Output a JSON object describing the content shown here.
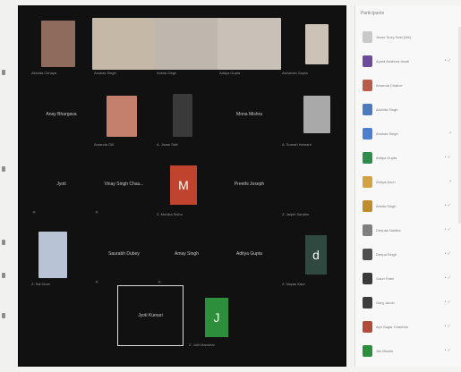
{
  "participants_panel": {
    "title": "Participants",
    "items": [
      {
        "name": "Jesse Suzy Host (Me)",
        "color": "#c9c9c9",
        "status": ""
      },
      {
        "name": "Ayara Andiswa Issati",
        "color": "#6d4a9b",
        "status": "• ✓"
      },
      {
        "name": "Amanda Challoe",
        "color": "#b95c4a",
        "status": ""
      },
      {
        "name": "Akshita Singh",
        "color": "#4b7abf",
        "status": ""
      },
      {
        "name": "Anukas Singh",
        "color": "#4d7fd0",
        "status": "•"
      },
      {
        "name": "Aditya Gupta",
        "color": "#2f8d4b",
        "status": "• ✓"
      },
      {
        "name": "Aneya Anuh",
        "color": "#d2a243",
        "status": "•"
      },
      {
        "name": "Ankita Singh",
        "color": "#bd8d2e",
        "status": "• ✓"
      },
      {
        "name": "Deepak Naidha",
        "color": "#7f7f7f",
        "status": "• ✓"
      },
      {
        "name": "Deepa Singh",
        "color": "#4f4f4f",
        "status": "• ✓"
      },
      {
        "name": "Gauri Patel",
        "color": "#3a3a3a",
        "status": "• ✓"
      },
      {
        "name": "Garg Jacob",
        "color": "#3c3c3c",
        "status": "• ✓"
      },
      {
        "name": "Ayo Sagar Chauhan",
        "color": "#b14d3a",
        "status": "• ✓"
      },
      {
        "name": "Jitu Bhatia",
        "color": "#2c8f3d",
        "status": "• ✓"
      }
    ]
  },
  "meeting": {
    "tiles": [
      {
        "name": "Akshita Chhaya",
        "label": "",
        "video": "#8f6b5d",
        "letter": ""
      },
      {
        "name": "Anukas Singh",
        "label": "",
        "video": "#c5b8a7",
        "letter": ""
      },
      {
        "name": "Ankita Singh",
        "label": "",
        "video": "#bfb7ae",
        "letter": ""
      },
      {
        "name": "Aditya Gupta",
        "label": "",
        "video": "#c9c1b8",
        "letter": ""
      },
      {
        "name": "Ashutosh Gupta",
        "label": "",
        "video": "#ccc2b6",
        "letter": ""
      },
      {
        "name": "",
        "label": "Anay Bhargava",
        "video": "",
        "letter": ""
      },
      {
        "name": "Amanda Gill",
        "label": "",
        "video": "#c47f6d",
        "letter": ""
      },
      {
        "name": "A. Jiwan Seth",
        "label": "",
        "video": "#3a3a3a",
        "letter": ""
      },
      {
        "name": "",
        "label": "Mona Mishra",
        "video": "",
        "letter": ""
      },
      {
        "name": "A. Suresh Hemant",
        "label": "",
        "video": "#a9a9a9",
        "letter": ""
      },
      {
        "name": "",
        "label": "Jyoti",
        "video": "",
        "letter": ""
      },
      {
        "name": "",
        "label": "Vinay Singh Chau...",
        "video": "",
        "letter": ""
      },
      {
        "name": "Z. Monika Sisha",
        "label": "",
        "video": "#c0432d",
        "letter": "M"
      },
      {
        "name": "",
        "label": "Preethi Joseph",
        "video": "",
        "letter": ""
      },
      {
        "name": "Z. Jaiprit Sandhu",
        "label": "",
        "video": "",
        "letter": ""
      },
      {
        "name": "Z. Sai Kiran",
        "label": "",
        "video": "#b8c3d5",
        "letter": ""
      },
      {
        "name": "",
        "label": "Saurabh Dubey",
        "video": "",
        "letter": ""
      },
      {
        "name": "",
        "label": "Amay Singh",
        "video": "",
        "letter": ""
      },
      {
        "name": "",
        "label": "Aditya Gupta",
        "video": "",
        "letter": ""
      },
      {
        "name": "Z. Nayan Kaur",
        "label": "",
        "video": "#2f4940",
        "letter": "d"
      },
      {
        "name": "",
        "label": "Jyoti Kumari",
        "video": "",
        "letter": ""
      },
      {
        "name": "Z. Juhi Manohar",
        "label": "",
        "video": "#2d8f3c",
        "letter": "J"
      }
    ]
  }
}
